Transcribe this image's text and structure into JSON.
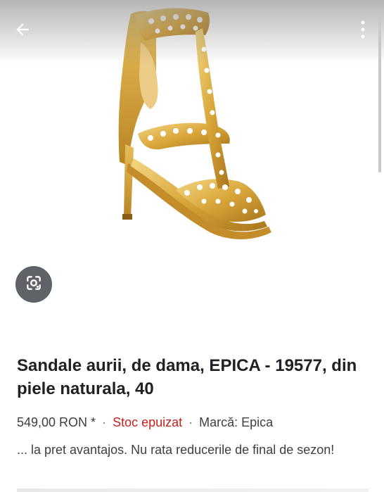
{
  "header": {
    "back_icon": "arrow-back-icon",
    "menu_icon": "more-vertical-icon"
  },
  "image": {
    "subject": "gold cut-out high-heel sandal",
    "colors": {
      "gold": "#d9a63a",
      "gold_dark": "#a9761c",
      "gold_light": "#f1d27a"
    }
  },
  "lens": {
    "icon": "google-lens-icon",
    "color": "#5f6368"
  },
  "product": {
    "title": "Sandale aurii, de dama, EPICA - 19577, din piele naturala, 40",
    "price": "549,00 RON *",
    "separator": "·",
    "stock": "Stoc epuizat",
    "brand": "Marcă: Epica",
    "description": "... la pret avantajos. Nu rata reducerile de final de sezon!"
  },
  "colors": {
    "stock_red": "#c5221f",
    "text": "#202124",
    "secondary": "#3c4043"
  }
}
